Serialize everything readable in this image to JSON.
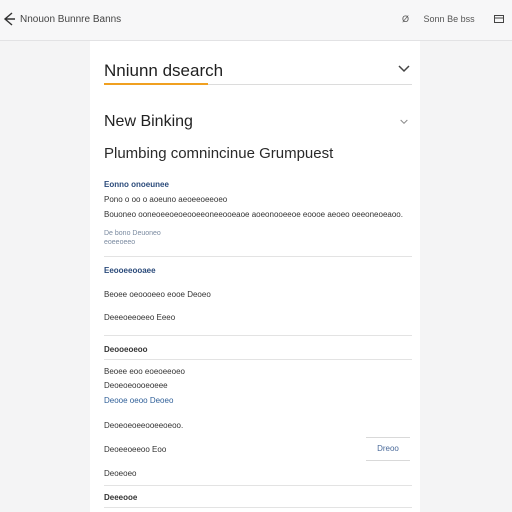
{
  "topbar": {
    "title": "Nnouon Bunnre Banns",
    "right_items": [
      "Ø",
      "Sonn",
      "Be",
      "bss"
    ],
    "icons": {
      "back": "back-arrow-icon",
      "window": "window-icon"
    }
  },
  "panel": {
    "search_heading": "Nniunn dsearch",
    "new_heading": "New Binking",
    "subheading": "Plumbing comnincinue Grumpuest",
    "block1": {
      "label": "Eonno onoeunee",
      "line1": "Pono o oo o aoeuno aeoeeoeeoeo",
      "line2": "Bouoneo ooneoeeoeoeooeeoneeooeaoe aoeonooeeoe eoooe aeoeo oeeoneoeaoo.",
      "link": "De bono Deuoneo",
      "note": "eoeeoeeo"
    },
    "section1": {
      "label": "Eeooeeooaee",
      "item1": "Beoee oeoooeeo eooe Deoeo",
      "item2": "Deeeoeeoeeo Eeeo"
    },
    "section2": {
      "label": "Deooeoeoo",
      "item1": "Beoee eoo eoeoeeoeo",
      "item2": "Deoeoeoooeoeee",
      "item3": "Deooe oeoo Deoeo"
    },
    "section3": {
      "item1": "Deoeoeoeeooeeoeoo.",
      "item2": "Deoeeoeeoo Eoo",
      "button": "Dreoo",
      "item3": "Deoeoeo",
      "item4": "Deeeooe"
    }
  }
}
